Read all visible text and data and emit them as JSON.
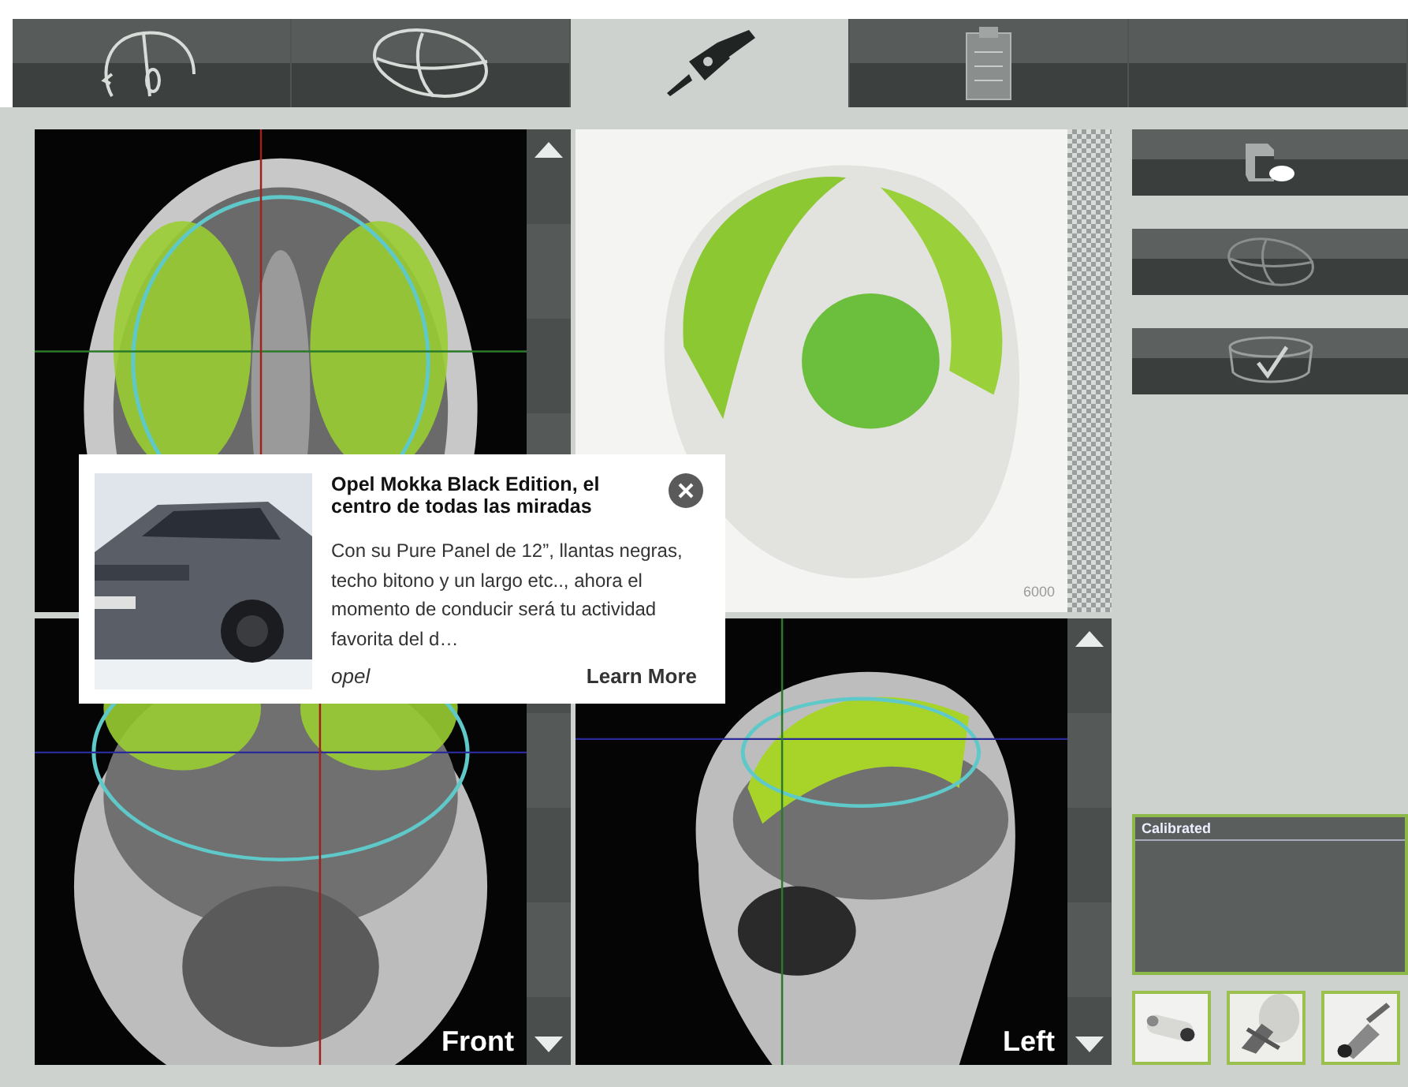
{
  "toolbar": {
    "tabs": [
      {
        "kind": "head",
        "selected": false
      },
      {
        "kind": "ellipsoid",
        "selected": false
      },
      {
        "kind": "probe",
        "selected": true
      },
      {
        "kind": "clipboard",
        "selected": false
      },
      {
        "kind": "blank",
        "selected": false
      }
    ]
  },
  "views": [
    {
      "kind": "axial"
    },
    {
      "kind": "render3d",
      "label": "6000"
    },
    {
      "kind": "coronal",
      "label": "Front"
    },
    {
      "kind": "sagittal",
      "label": "Left"
    }
  ],
  "side_buttons": [
    {
      "kind": "pointer-cube"
    },
    {
      "kind": "ellipsoid"
    },
    {
      "kind": "check-dish"
    }
  ],
  "status_panel": {
    "title": "Calibrated"
  },
  "ad": {
    "headline": "Opel Mokka Black Edition, el centro de todas las miradas",
    "body": "Con su Pure Panel de 12”, llantas negras, techo bitono y un largo etc.., ahora el momento de conducir será tu actividad favorita del d…",
    "advertiser": "opel",
    "cta": "Learn More"
  }
}
